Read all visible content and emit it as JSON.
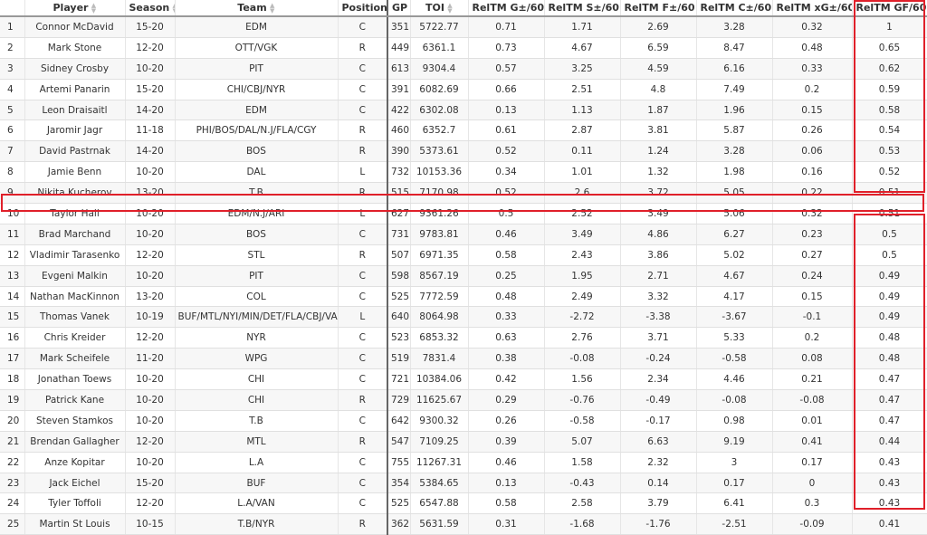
{
  "headers": [
    "",
    "Player",
    "Season",
    "Team",
    "Position",
    "GP",
    "TOI",
    "RelTM G±/60",
    "RelTM S±/60",
    "RelTM F±/60",
    "RelTM C±/60",
    "RelTM xG±/60",
    "RelTM GF/60"
  ],
  "sort_icon": "sort-arrows-icon",
  "highlight_color": "#e0202a",
  "rows": [
    [
      "1",
      "Connor McDavid",
      "15-20",
      "EDM",
      "C",
      "351",
      "5722.77",
      "0.71",
      "1.71",
      "2.69",
      "3.28",
      "0.32",
      "1"
    ],
    [
      "2",
      "Mark Stone",
      "12-20",
      "OTT/VGK",
      "R",
      "449",
      "6361.1",
      "0.73",
      "4.67",
      "6.59",
      "8.47",
      "0.48",
      "0.65"
    ],
    [
      "3",
      "Sidney Crosby",
      "10-20",
      "PIT",
      "C",
      "613",
      "9304.4",
      "0.57",
      "3.25",
      "4.59",
      "6.16",
      "0.33",
      "0.62"
    ],
    [
      "4",
      "Artemi Panarin",
      "15-20",
      "CHI/CBJ/NYR",
      "C",
      "391",
      "6082.69",
      "0.66",
      "2.51",
      "4.8",
      "7.49",
      "0.2",
      "0.59"
    ],
    [
      "5",
      "Leon Draisaitl",
      "14-20",
      "EDM",
      "C",
      "422",
      "6302.08",
      "0.13",
      "1.13",
      "1.87",
      "1.96",
      "0.15",
      "0.58"
    ],
    [
      "6",
      "Jaromir Jagr",
      "11-18",
      "PHI/BOS/DAL/N.J/FLA/CGY",
      "R",
      "460",
      "6352.7",
      "0.61",
      "2.87",
      "3.81",
      "5.87",
      "0.26",
      "0.54"
    ],
    [
      "7",
      "David Pastrnak",
      "14-20",
      "BOS",
      "R",
      "390",
      "5373.61",
      "0.52",
      "0.11",
      "1.24",
      "3.28",
      "0.06",
      "0.53"
    ],
    [
      "8",
      "Jamie Benn",
      "10-20",
      "DAL",
      "L",
      "732",
      "10153.36",
      "0.34",
      "1.01",
      "1.32",
      "1.98",
      "0.16",
      "0.52"
    ],
    [
      "9",
      "Nikita Kucherov",
      "13-20",
      "T.B",
      "R",
      "515",
      "7170.98",
      "0.52",
      "2.6",
      "3.72",
      "5.05",
      "0.22",
      "0.51"
    ],
    [
      "10",
      "Taylor Hall",
      "10-20",
      "EDM/N.J/ARI",
      "L",
      "627",
      "9361.26",
      "0.5",
      "2.52",
      "3.49",
      "5.06",
      "0.32",
      "0.51"
    ],
    [
      "11",
      "Brad Marchand",
      "10-20",
      "BOS",
      "C",
      "731",
      "9783.81",
      "0.46",
      "3.49",
      "4.86",
      "6.27",
      "0.23",
      "0.5"
    ],
    [
      "12",
      "Vladimir Tarasenko",
      "12-20",
      "STL",
      "R",
      "507",
      "6971.35",
      "0.58",
      "2.43",
      "3.86",
      "5.02",
      "0.27",
      "0.5"
    ],
    [
      "13",
      "Evgeni Malkin",
      "10-20",
      "PIT",
      "C",
      "598",
      "8567.19",
      "0.25",
      "1.95",
      "2.71",
      "4.67",
      "0.24",
      "0.49"
    ],
    [
      "14",
      "Nathan MacKinnon",
      "13-20",
      "COL",
      "C",
      "525",
      "7772.59",
      "0.48",
      "2.49",
      "3.32",
      "4.17",
      "0.15",
      "0.49"
    ],
    [
      "15",
      "Thomas Vanek",
      "10-19",
      "BUF/MTL/NYI/MIN/DET/FLA/CBJ/VAN",
      "L",
      "640",
      "8064.98",
      "0.33",
      "-2.72",
      "-3.38",
      "-3.67",
      "-0.1",
      "0.49"
    ],
    [
      "16",
      "Chris Kreider",
      "12-20",
      "NYR",
      "C",
      "523",
      "6853.32",
      "0.63",
      "2.76",
      "3.71",
      "5.33",
      "0.2",
      "0.48"
    ],
    [
      "17",
      "Mark Scheifele",
      "11-20",
      "WPG",
      "C",
      "519",
      "7831.4",
      "0.38",
      "-0.08",
      "-0.24",
      "-0.58",
      "0.08",
      "0.48"
    ],
    [
      "18",
      "Jonathan Toews",
      "10-20",
      "CHI",
      "C",
      "721",
      "10384.06",
      "0.42",
      "1.56",
      "2.34",
      "4.46",
      "0.21",
      "0.47"
    ],
    [
      "19",
      "Patrick Kane",
      "10-20",
      "CHI",
      "R",
      "729",
      "11625.67",
      "0.29",
      "-0.76",
      "-0.49",
      "-0.08",
      "-0.08",
      "0.47"
    ],
    [
      "20",
      "Steven Stamkos",
      "10-20",
      "T.B",
      "C",
      "642",
      "9300.32",
      "0.26",
      "-0.58",
      "-0.17",
      "0.98",
      "0.01",
      "0.47"
    ],
    [
      "21",
      "Brendan Gallagher",
      "12-20",
      "MTL",
      "R",
      "547",
      "7109.25",
      "0.39",
      "5.07",
      "6.63",
      "9.19",
      "0.41",
      "0.44"
    ],
    [
      "22",
      "Anze Kopitar",
      "10-20",
      "L.A",
      "C",
      "755",
      "11267.31",
      "0.46",
      "1.58",
      "2.32",
      "3",
      "0.17",
      "0.43"
    ],
    [
      "23",
      "Jack Eichel",
      "15-20",
      "BUF",
      "C",
      "354",
      "5384.65",
      "0.13",
      "-0.43",
      "0.14",
      "0.17",
      "0",
      "0.43"
    ],
    [
      "24",
      "Tyler Toffoli",
      "12-20",
      "L.A/VAN",
      "C",
      "525",
      "6547.88",
      "0.58",
      "2.58",
      "3.79",
      "6.41",
      "0.3",
      "0.43"
    ],
    [
      "25",
      "Martin St Louis",
      "10-15",
      "T.B/NYR",
      "R",
      "362",
      "5631.59",
      "0.31",
      "-1.68",
      "-1.76",
      "-2.51",
      "-0.09",
      "0.41"
    ]
  ]
}
